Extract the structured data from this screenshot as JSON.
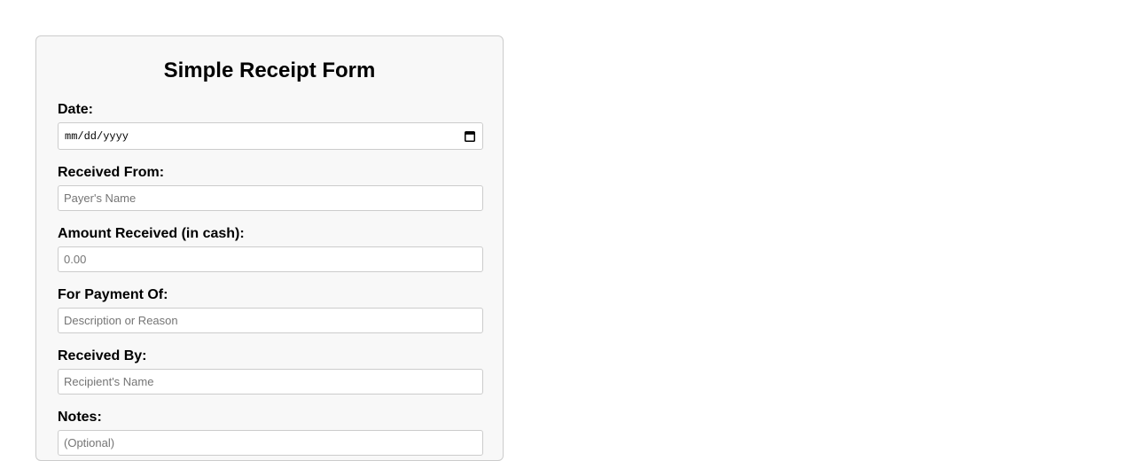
{
  "form": {
    "title": "Simple Receipt Form",
    "fields": {
      "date": {
        "label": "Date:",
        "placeholder": "mm/dd/yyyy",
        "icon": "calendar-icon"
      },
      "received_from": {
        "label": "Received From:",
        "placeholder": "Payer's Name",
        "value": ""
      },
      "amount": {
        "label": "Amount Received (in cash):",
        "placeholder": "0.00",
        "value": ""
      },
      "payment_of": {
        "label": "For Payment Of:",
        "placeholder": "Description or Reason",
        "value": ""
      },
      "received_by": {
        "label": "Received By:",
        "placeholder": "Recipient's Name",
        "value": ""
      },
      "notes": {
        "label": "Notes:",
        "placeholder": "(Optional)",
        "value": ""
      }
    }
  }
}
